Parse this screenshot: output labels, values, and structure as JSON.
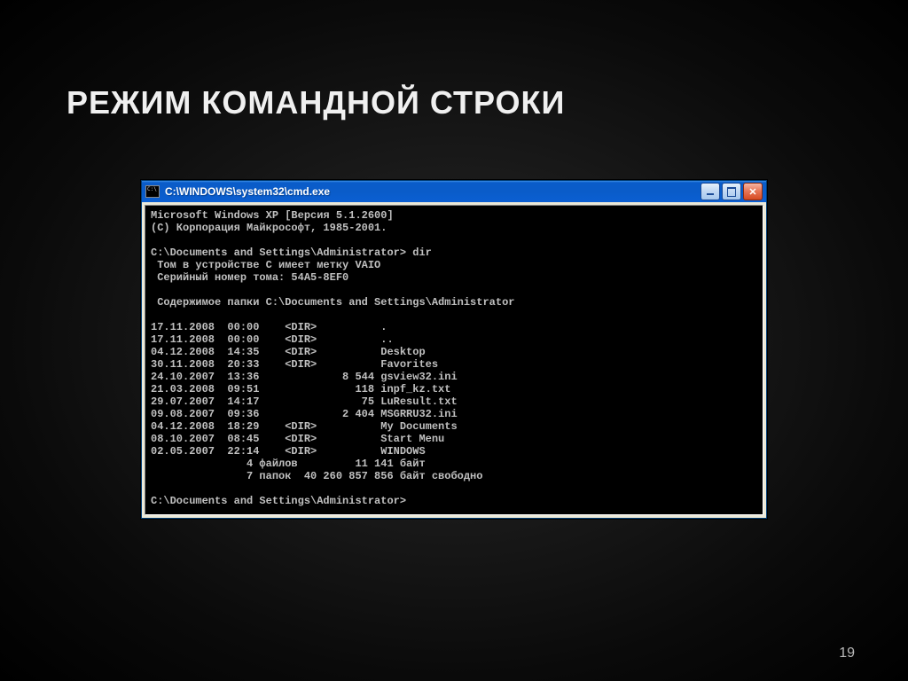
{
  "slide": {
    "title": "РЕЖИМ КОМАНДНОЙ СТРОКИ",
    "page_number": "19"
  },
  "window": {
    "title": "C:\\WINDOWS\\system32\\cmd.exe"
  },
  "console": {
    "header1": "Microsoft Windows XP [Версия 5.1.2600]",
    "header2": "(C) Корпорация Майкрософт, 1985-2001.",
    "prompt1": "C:\\Documents and Settings\\Administrator> dir",
    "vol1": " Том в устройстве C имеет метку VAIO",
    "vol2": " Серийный номер тома: 54A5-8EF0",
    "contents_header": " Содержимое папки C:\\Documents and Settings\\Administrator",
    "entries": [
      "17.11.2008  00:00    <DIR>          .",
      "17.11.2008  00:00    <DIR>          ..",
      "04.12.2008  14:35    <DIR>          Desktop",
      "30.11.2008  20:33    <DIR>          Favorites",
      "24.10.2007  13:36             8 544 gsview32.ini",
      "21.03.2008  09:51               118 inpf_kz.txt",
      "29.07.2007  14:17                75 LuResult.txt",
      "09.08.2007  09:36             2 404 MSGRRU32.ini",
      "04.12.2008  18:29    <DIR>          My Documents",
      "08.10.2007  08:45    <DIR>          Start Menu",
      "02.05.2007  22:14    <DIR>          WINDOWS"
    ],
    "summary1": "               4 файлов         11 141 байт",
    "summary2": "               7 папок  40 260 857 856 байт свободно",
    "prompt2": "C:\\Documents and Settings\\Administrator>"
  }
}
